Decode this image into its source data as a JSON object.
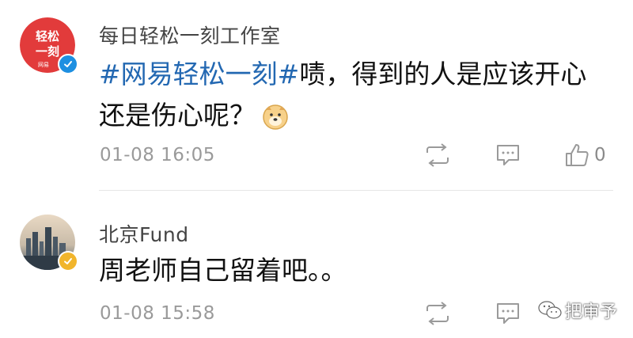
{
  "posts": [
    {
      "username": "每日轻松一刻工作室",
      "avatar_text_top": "轻松",
      "avatar_text_bottom": "一刻",
      "avatar_label": "网易",
      "verified_color": "#1d8fe1",
      "hashtag": "#网易轻松一刻#",
      "text": "啧，得到的人是应该开心还是伤心呢？",
      "emoji": "doge-icon",
      "timestamp": "01-08 16:05",
      "like_count": "0"
    },
    {
      "username": "北京Fund",
      "verified_color": "#f1b52c",
      "text": "周老师自己留着吧。。",
      "timestamp": "01-08 15:58"
    }
  ],
  "watermark": {
    "text": "把审予",
    "icon": "wechat-icon"
  },
  "colors": {
    "hashtag": "#2368b2",
    "meta": "#9a9a9a"
  }
}
